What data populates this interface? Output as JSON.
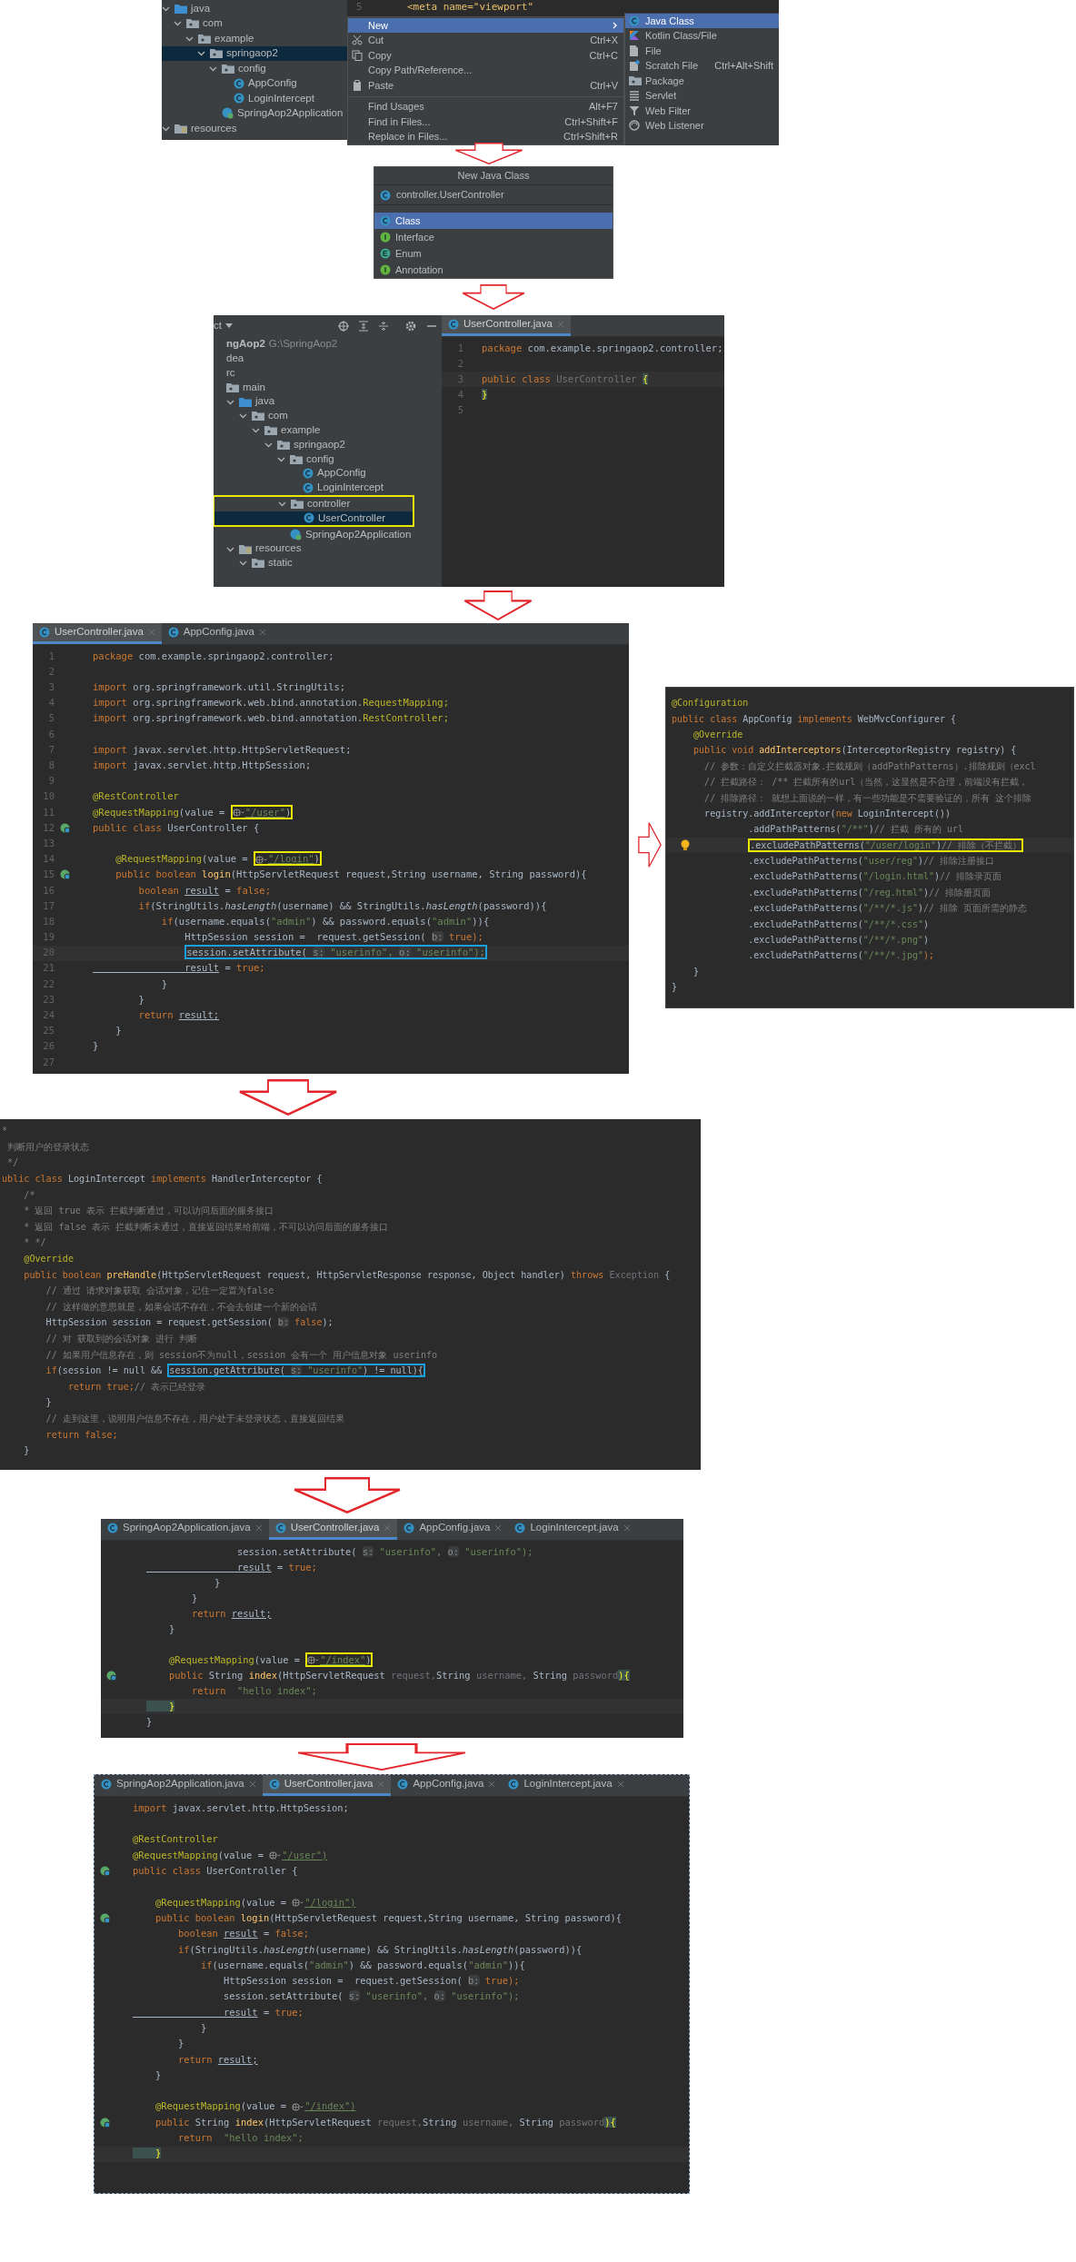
{
  "menu_screenshot": {
    "tree": [
      {
        "label": "java",
        "kind": "source",
        "expanded": true,
        "selected": false,
        "children": [
          {
            "label": "com",
            "kind": "folder",
            "expanded": true,
            "selected": false,
            "children": [
              {
                "label": "example",
                "kind": "folder",
                "expanded": true,
                "selected": false,
                "children": [
                  {
                    "label": "springaop2",
                    "kind": "folder",
                    "expanded": true,
                    "selected": true,
                    "children": [
                      {
                        "label": "config",
                        "kind": "folder",
                        "expanded": true,
                        "selected": false,
                        "children": [
                          {
                            "label": "AppConfig",
                            "kind": "class",
                            "selected": false
                          },
                          {
                            "label": "LoginIntercept",
                            "kind": "class",
                            "selected": false
                          }
                        ]
                      },
                      {
                        "label": "SpringAop2Application",
                        "kind": "app",
                        "selected": false
                      }
                    ]
                  }
                ]
              }
            ]
          }
        ]
      },
      {
        "label": "resources",
        "kind": "resources",
        "expanded": true,
        "selected": false
      }
    ],
    "editor_line": {
      "number": "5",
      "text": "<meta name=\"viewport\""
    },
    "menu": [
      {
        "kind": "submenu",
        "label": "New",
        "selected": true
      },
      {
        "kind": "cut",
        "label": "Cut",
        "shortcut": "Ctrl+X",
        "selected": false
      },
      {
        "kind": "copy",
        "label": "Copy",
        "shortcut": "Ctrl+C",
        "selected": false
      },
      {
        "kind": "plain",
        "label": "Copy Path/Reference...",
        "selected": false
      },
      {
        "kind": "paste",
        "label": "Paste",
        "shortcut": "Ctrl+V",
        "selected": false
      },
      {
        "kind": "separator"
      },
      {
        "kind": "plain",
        "label": "Find Usages",
        "shortcut": "Alt+F7",
        "selected": false
      },
      {
        "kind": "plain",
        "label": "Find in Files...",
        "shortcut": "Ctrl+Shift+F",
        "selected": false
      },
      {
        "kind": "plain",
        "label": "Replace in Files...",
        "shortcut": "Ctrl+Shift+R",
        "selected": false
      }
    ],
    "submenu": [
      {
        "kind": "class",
        "label": "Java Class",
        "selected": true
      },
      {
        "kind": "kotlin",
        "label": "Kotlin Class/File",
        "selected": false
      },
      {
        "kind": "file",
        "label": "File",
        "selected": false
      },
      {
        "kind": "scratch",
        "label": "Scratch File",
        "shortcut": "Ctrl+Alt+Shift",
        "selected": false
      },
      {
        "kind": "package",
        "label": "Package",
        "selected": false
      },
      {
        "kind": "servlet",
        "label": "Servlet",
        "selected": false
      },
      {
        "kind": "filter",
        "label": "Web Filter",
        "selected": false
      },
      {
        "kind": "listener",
        "label": "Web Listener",
        "selected": false
      }
    ]
  },
  "new_class_dialog": {
    "title": "New Java Class",
    "value": "controller.UserController",
    "options": [
      {
        "kind": "class",
        "label": "Class",
        "selected": true
      },
      {
        "kind": "interface",
        "label": "Interface",
        "selected": false
      },
      {
        "kind": "enum",
        "label": "Enum",
        "selected": false
      },
      {
        "kind": "annotation",
        "label": "Annotation",
        "selected": false
      }
    ]
  },
  "project_screenshot": {
    "toolbar_label": "ct",
    "tree": [
      {
        "label": "ngAop2",
        "path": "G:\\SpringAop2",
        "kind": "text",
        "selected": false
      },
      {
        "label": "dea",
        "kind": "text",
        "selected": false
      },
      {
        "label": "rc",
        "kind": "text",
        "selected": false
      },
      {
        "label": "main",
        "kind": "folder",
        "selected": false,
        "children": [
          {
            "label": "java",
            "kind": "source",
            "expanded": true,
            "selected": false,
            "children": [
              {
                "label": "com",
                "kind": "folder",
                "expanded": true,
                "selected": false,
                "children": [
                  {
                    "label": "example",
                    "kind": "folder",
                    "expanded": true,
                    "selected": false,
                    "children": [
                      {
                        "label": "springaop2",
                        "kind": "folder",
                        "expanded": true,
                        "selected": false,
                        "children": [
                          {
                            "label": "config",
                            "kind": "folder",
                            "expanded": true,
                            "selected": false,
                            "children": [
                              {
                                "label": "AppConfig",
                                "kind": "class",
                                "selected": false
                              },
                              {
                                "label": "LoginIntercept",
                                "kind": "class",
                                "selected": false
                              }
                            ]
                          },
                          {
                            "label": "controller",
                            "kind": "folder",
                            "expanded": true,
                            "selected": false,
                            "boxed": true,
                            "children": [
                              {
                                "label": "UserController",
                                "kind": "class",
                                "selected": true
                              }
                            ]
                          },
                          {
                            "label": "SpringAop2Application",
                            "kind": "app",
                            "selected": false
                          }
                        ]
                      }
                    ]
                  }
                ]
              }
            ]
          },
          {
            "label": "resources",
            "kind": "resources",
            "expanded": true,
            "selected": false,
            "children": [
              {
                "label": "static",
                "kind": "folder",
                "expanded": true,
                "selected": false
              }
            ]
          }
        ]
      }
    ],
    "tabs": [
      {
        "label": "UserController.java",
        "selected": true
      }
    ],
    "lines": [
      {
        "number": "1",
        "segments": [
          {
            "kind": "keyword",
            "text": "package "
          },
          {
            "kind": "plain",
            "text": "com.example.springaop2.controller;"
          }
        ]
      },
      {
        "number": "2"
      },
      {
        "number": "3",
        "current": true,
        "segments": [
          {
            "kind": "keyword",
            "text": "public class "
          },
          {
            "kind": "muted",
            "text": "UserController "
          },
          {
            "kind": "brace",
            "text": "{"
          }
        ]
      },
      {
        "number": "4",
        "segments": [
          {
            "kind": "brace",
            "text": "}"
          }
        ]
      },
      {
        "number": "5"
      }
    ]
  },
  "user_controller": {
    "tabs": [
      {
        "label": "UserController.java",
        "selected": true
      },
      {
        "label": "AppConfig.java",
        "selected": false
      }
    ],
    "lines": [
      {
        "number": "1",
        "segments": [
          {
            "kind": "keyword",
            "text": "package "
          },
          {
            "kind": "plain",
            "text": "com.example.springaop2.controller;"
          }
        ]
      },
      {
        "number": "2"
      },
      {
        "number": "3",
        "segments": [
          {
            "kind": "keyword",
            "text": "import "
          },
          {
            "kind": "plain",
            "text": "org.springframework.util.StringUtils;"
          }
        ]
      },
      {
        "number": "4",
        "segments": [
          {
            "kind": "keyword",
            "text": "import "
          },
          {
            "kind": "plain",
            "text": "org.springframework.web.bind.annotation."
          },
          {
            "kind": "annotation",
            "text": "RequestMapping;"
          }
        ]
      },
      {
        "number": "5",
        "segments": [
          {
            "kind": "keyword",
            "text": "import "
          },
          {
            "kind": "plain",
            "text": "org.springframework.web.bind.annotation."
          },
          {
            "kind": "annotation",
            "text": "RestController;"
          }
        ]
      },
      {
        "number": "6"
      },
      {
        "number": "7",
        "segments": [
          {
            "kind": "keyword",
            "text": "import "
          },
          {
            "kind": "plain",
            "text": "javax.servlet.http.HttpServletRequest;"
          }
        ]
      },
      {
        "number": "8",
        "segments": [
          {
            "kind": "keyword",
            "text": "import "
          },
          {
            "kind": "plain",
            "text": "javax.servlet.http.HttpSession;"
          }
        ]
      },
      {
        "number": "9"
      },
      {
        "number": "10",
        "segments": [
          {
            "kind": "annotation",
            "text": "@RestController"
          }
        ]
      },
      {
        "number": "11",
        "segments": [
          {
            "kind": "annotation",
            "text": "@RequestMapping"
          },
          {
            "kind": "plain",
            "text": "(value = "
          },
          {
            "kind": "box",
            "color": "#e8e800",
            "segments": [
              {
                "kind": "globe"
              },
              {
                "kind": "url",
                "text": "\"/user\""
              },
              {
                "kind": "plain",
                "text": ")"
              }
            ]
          }
        ]
      },
      {
        "number": "12",
        "gutter": {
          "kind": "bean"
        },
        "segments": [
          {
            "kind": "keyword",
            "text": "public class "
          },
          {
            "kind": "plain",
            "text": "UserController {"
          }
        ]
      },
      {
        "number": "13"
      },
      {
        "number": "14",
        "segments": [
          {
            "kind": "annotation",
            "text": "    @RequestMapping"
          },
          {
            "kind": "plain",
            "text": "(value = "
          },
          {
            "kind": "box",
            "color": "#e8e800",
            "segments": [
              {
                "kind": "globe"
              },
              {
                "kind": "url",
                "text": "\"/login\""
              },
              {
                "kind": "plain",
                "text": ")"
              }
            ]
          }
        ]
      },
      {
        "number": "15",
        "gutter": {
          "kind": "bean"
        },
        "segments": [
          {
            "kind": "keyword",
            "text": "    public boolean "
          },
          {
            "kind": "method",
            "text": "login"
          },
          {
            "kind": "plain",
            "text": "(HttpServletRequest request,String username, String password){"
          }
        ]
      },
      {
        "number": "16",
        "segments": [
          {
            "kind": "keyword",
            "text": "        boolean "
          },
          {
            "kind": "underline",
            "text": "result"
          },
          {
            "kind": "plain",
            "text": " = "
          },
          {
            "kind": "keyword",
            "text": "false;"
          }
        ]
      },
      {
        "number": "17",
        "segments": [
          {
            "kind": "keyword",
            "text": "        if"
          },
          {
            "kind": "plain",
            "text": "(StringUtils."
          },
          {
            "kind": "italic",
            "text": "hasLength"
          },
          {
            "kind": "plain",
            "text": "(username) && StringUtils."
          },
          {
            "kind": "italic",
            "text": "hasLength"
          },
          {
            "kind": "plain",
            "text": "(password)){"
          }
        ]
      },
      {
        "number": "18",
        "segments": [
          {
            "kind": "keyword",
            "text": "            if"
          },
          {
            "kind": "plain",
            "text": "(username.equals("
          },
          {
            "kind": "string",
            "text": "\"admin\""
          },
          {
            "kind": "plain",
            "text": ") && password.equals("
          },
          {
            "kind": "string",
            "text": "\"admin\""
          },
          {
            "kind": "plain",
            "text": ")){"
          }
        ]
      },
      {
        "number": "19",
        "segments": [
          {
            "kind": "plain",
            "text": "                HttpSession session =  request.getSession( "
          },
          {
            "kind": "hint",
            "text": "b:"
          },
          {
            "kind": "keyword",
            "text": " true);"
          }
        ]
      },
      {
        "number": "20",
        "current": true,
        "segments": [
          {
            "kind": "box",
            "color": "#1a9fe0",
            "segments": [
              {
                "kind": "plain",
                "text": "                session.setAttribute( "
              },
              {
                "kind": "hint",
                "text": "s:"
              },
              {
                "kind": "string",
                "text": " \"userinfo\", "
              },
              {
                "kind": "hint",
                "text": "o:"
              },
              {
                "kind": "string",
                "text": " \"userinfo\");"
              }
            ]
          }
        ]
      },
      {
        "number": "21",
        "segments": [
          {
            "kind": "underline",
            "text": "                result"
          },
          {
            "kind": "plain",
            "text": " = "
          },
          {
            "kind": "keyword",
            "text": "true;"
          }
        ]
      },
      {
        "number": "22",
        "segments": [
          {
            "kind": "plain",
            "text": "            }"
          }
        ]
      },
      {
        "number": "23",
        "segments": [
          {
            "kind": "plain",
            "text": "        }"
          }
        ]
      },
      {
        "number": "24",
        "segments": [
          {
            "kind": "keyword",
            "text": "        return "
          },
          {
            "kind": "underline",
            "text": "result;"
          }
        ]
      },
      {
        "number": "25",
        "segments": [
          {
            "kind": "plain",
            "text": "    }"
          }
        ]
      },
      {
        "number": "26",
        "segments": [
          {
            "kind": "plain",
            "text": "}"
          }
        ]
      },
      {
        "number": "27"
      }
    ]
  },
  "app_config": {
    "lines": [
      {
        "segments": [
          {
            "kind": "annotation",
            "text": "@Configuration"
          }
        ]
      },
      {
        "segments": [
          {
            "kind": "keyword",
            "text": "public class "
          },
          {
            "kind": "plain",
            "text": "AppConfig "
          },
          {
            "kind": "keyword",
            "text": "implements "
          },
          {
            "kind": "plain",
            "text": "WebMvcConfigurer {"
          }
        ]
      },
      {
        "segments": [
          {
            "kind": "annotation",
            "text": "    @Override"
          }
        ]
      },
      {
        "segments": [
          {
            "kind": "keyword",
            "text": "    public void "
          },
          {
            "kind": "method",
            "text": "addInterceptors"
          },
          {
            "kind": "plain",
            "text": "(InterceptorRegistry registry) {"
          }
        ]
      },
      {
        "segments": [
          {
            "kind": "comment",
            "text": "      // 参数：自定义拦截器对象.拦截规则（addPathPatterns）.排除规则（excl"
          }
        ]
      },
      {
        "segments": [
          {
            "kind": "comment",
            "text": "      // 拦截路径： /** 拦截所有的url（当然，这显然是不合理，前端没有拦截，"
          }
        ]
      },
      {
        "segments": [
          {
            "kind": "comment",
            "text": "      // 排除路径： 就想上面说的一样，有一些功能是不需要验证的，所有 这个排除"
          }
        ]
      },
      {
        "segments": [
          {
            "kind": "plain",
            "text": "      registry.addInterceptor("
          },
          {
            "kind": "keyword",
            "text": "new "
          },
          {
            "kind": "plain",
            "text": "LoginIntercept())"
          }
        ]
      },
      {
        "segments": [
          {
            "kind": "plain",
            "text": "              .addPathPatterns("
          },
          {
            "kind": "string",
            "text": "\"/**\""
          },
          {
            "kind": "plain",
            "text": ")"
          },
          {
            "kind": "comment",
            "text": "// 拦截 所有的 url"
          }
        ]
      },
      {
        "current": true,
        "gutter": {
          "kind": "bulb"
        },
        "segments": [
          {
            "kind": "box",
            "color": "#e8e800",
            "segments": [
              {
                "kind": "plain",
                "text": "              .excludePathPatterns("
              },
              {
                "kind": "string",
                "text": "\"/user/login\""
              },
              {
                "kind": "plain",
                "text": ")"
              },
              {
                "kind": "comment",
                "text": "// 排除（不拦截）"
              }
            ]
          }
        ]
      },
      {
        "segments": [
          {
            "kind": "plain",
            "text": "              .excludePathPatterns("
          },
          {
            "kind": "string",
            "text": "\"user/reg\""
          },
          {
            "kind": "plain",
            "text": ")"
          },
          {
            "kind": "comment",
            "text": "// 排除注册接口"
          }
        ]
      },
      {
        "segments": [
          {
            "kind": "plain",
            "text": "              .excludePathPatterns("
          },
          {
            "kind": "string",
            "text": "\"/login.html\""
          },
          {
            "kind": "plain",
            "text": ")"
          },
          {
            "kind": "comment",
            "text": "// 排除录页面"
          }
        ]
      },
      {
        "segments": [
          {
            "kind": "plain",
            "text": "              .excludePathPatterns("
          },
          {
            "kind": "string",
            "text": "\"/reg.html\""
          },
          {
            "kind": "plain",
            "text": ")"
          },
          {
            "kind": "comment",
            "text": "// 排除册页面"
          }
        ]
      },
      {
        "segments": [
          {
            "kind": "plain",
            "text": "              .excludePathPatterns("
          },
          {
            "kind": "string",
            "text": "\"/**/*.js\""
          },
          {
            "kind": "plain",
            "text": ")"
          },
          {
            "kind": "comment",
            "text": "// 排除 页面所需的静态"
          }
        ]
      },
      {
        "segments": [
          {
            "kind": "plain",
            "text": "              .excludePathPatterns("
          },
          {
            "kind": "string",
            "text": "\"/**/*.css\""
          },
          {
            "kind": "plain",
            "text": ")"
          }
        ]
      },
      {
        "segments": [
          {
            "kind": "plain",
            "text": "              .excludePathPatterns("
          },
          {
            "kind": "string",
            "text": "\"/**/*.png\""
          },
          {
            "kind": "plain",
            "text": ")"
          }
        ]
      },
      {
        "segments": [
          {
            "kind": "plain",
            "text": "              .excludePathPatterns("
          },
          {
            "kind": "string",
            "text": "\"/**/*.jpg\""
          },
          {
            "kind": "keyword",
            "text": ");"
          }
        ]
      },
      {
        "segments": [
          {
            "kind": "plain",
            "text": "    }"
          }
        ]
      },
      {
        "segments": [
          {
            "kind": "plain",
            "text": "}"
          }
        ]
      }
    ]
  },
  "login_intercept": {
    "lines": [
      {
        "segments": [
          {
            "kind": "comment",
            "text": "*"
          }
        ]
      },
      {
        "segments": [
          {
            "kind": "comment",
            "text": " 判断用户的登录状态"
          }
        ]
      },
      {
        "segments": [
          {
            "kind": "comment",
            "text": " */"
          }
        ]
      },
      {
        "segments": [
          {
            "kind": "keyword",
            "text": "ublic class "
          },
          {
            "kind": "plain",
            "text": "LoginIntercept "
          },
          {
            "kind": "keyword",
            "text": "implements "
          },
          {
            "kind": "plain",
            "text": "HandlerInterceptor {"
          }
        ]
      },
      {
        "segments": [
          {
            "kind": "comment",
            "text": "    /*"
          }
        ]
      },
      {
        "segments": [
          {
            "kind": "comment",
            "text": "    * 返回 true 表示 拦截判断通过，可以访问后面的服务接口"
          }
        ]
      },
      {
        "segments": [
          {
            "kind": "comment",
            "text": "    * 返回 false 表示 拦截判断未通过，直接返回结果给前端，不可以访问后面的服务接口"
          }
        ]
      },
      {
        "segments": [
          {
            "kind": "comment",
            "text": "    * */"
          }
        ]
      },
      {
        "segments": [
          {
            "kind": "annotation",
            "text": "    @Override"
          }
        ]
      },
      {
        "segments": [
          {
            "kind": "keyword",
            "text": "    public boolean "
          },
          {
            "kind": "method",
            "text": "preHandle"
          },
          {
            "kind": "plain",
            "text": "(HttpServletRequest request, HttpServletResponse response, Object handler) "
          },
          {
            "kind": "keyword",
            "text": "throws "
          },
          {
            "kind": "muted",
            "text": "Exception "
          },
          {
            "kind": "plain",
            "text": "{"
          }
        ]
      },
      {
        "segments": [
          {
            "kind": "comment",
            "text": "        // 通过 请求对象获取 会话对象，记住一定置为false"
          }
        ]
      },
      {
        "segments": [
          {
            "kind": "comment",
            "text": "        // 这样做的意思就是，如果会话不存在，不会去创建一个新的会话"
          }
        ]
      },
      {
        "segments": [
          {
            "kind": "plain",
            "text": "        HttpSession session = request.getSession( "
          },
          {
            "kind": "hint",
            "text": "b:"
          },
          {
            "kind": "keyword",
            "text": " false"
          },
          {
            "kind": "plain",
            "text": ");"
          }
        ]
      },
      {
        "segments": [
          {
            "kind": "comment",
            "text": "        // 对 获取到的会话对象 进行 判断"
          }
        ]
      },
      {
        "segments": [
          {
            "kind": "comment",
            "text": "        // 如果用户信息存在，则 session不为null，session 会有一个 用户信息对象 userinfo"
          }
        ]
      },
      {
        "segments": [
          {
            "kind": "keyword",
            "text": "        if"
          },
          {
            "kind": "plain",
            "text": "(session != null && "
          },
          {
            "kind": "box",
            "color": "#1a9fe0",
            "segments": [
              {
                "kind": "plain",
                "text": "session.getAttribute( "
              },
              {
                "kind": "hint",
                "text": "s:"
              },
              {
                "kind": "string",
                "text": " \"userinfo\""
              },
              {
                "kind": "plain",
                "text": ") != null){"
              }
            ]
          }
        ]
      },
      {
        "segments": [
          {
            "kind": "keyword",
            "text": "            return true;"
          },
          {
            "kind": "comment",
            "text": "// 表示已经登录"
          }
        ]
      },
      {
        "segments": [
          {
            "kind": "plain",
            "text": "        }"
          }
        ]
      },
      {
        "segments": [
          {
            "kind": "comment",
            "text": "        // 走到这里，说明用户信息不存在，用户处于未登录状态，直接返回结果"
          }
        ]
      },
      {
        "segments": [
          {
            "kind": "keyword",
            "text": "        return false;"
          }
        ]
      },
      {
        "segments": [
          {
            "kind": "plain",
            "text": "    }"
          }
        ]
      }
    ]
  },
  "index_snippet": {
    "tabs": [
      {
        "label": "SpringAop2Application.java",
        "selected": false
      },
      {
        "label": "UserController.java",
        "selected": true
      },
      {
        "label": "AppConfig.java",
        "selected": false
      },
      {
        "label": "LoginIntercept.java",
        "selected": false
      }
    ],
    "lines": [
      {
        "segments": [
          {
            "kind": "plain",
            "text": "                session.setAttribute( "
          },
          {
            "kind": "hint",
            "text": "s:"
          },
          {
            "kind": "string",
            "text": " \"userinfo\", "
          },
          {
            "kind": "hint",
            "text": "o:"
          },
          {
            "kind": "string",
            "text": " \"userinfo\");"
          }
        ]
      },
      {
        "segments": [
          {
            "kind": "underline",
            "text": "                result"
          },
          {
            "kind": "plain",
            "text": " = "
          },
          {
            "kind": "keyword",
            "text": "true;"
          }
        ]
      },
      {
        "segments": [
          {
            "kind": "plain",
            "text": "            }"
          }
        ]
      },
      {
        "segments": [
          {
            "kind": "plain",
            "text": "        }"
          }
        ]
      },
      {
        "segments": [
          {
            "kind": "keyword",
            "text": "        return "
          },
          {
            "kind": "underline",
            "text": "result;"
          }
        ]
      },
      {
        "segments": [
          {
            "kind": "plain",
            "text": "    }"
          }
        ]
      },
      {
        "gap_before": true,
        "segments": [
          {
            "kind": "annotation",
            "text": "    @RequestMapping"
          },
          {
            "kind": "plain",
            "text": "(value = "
          },
          {
            "kind": "box",
            "color": "#e8e800",
            "segments": [
              {
                "kind": "globe"
              },
              {
                "kind": "url",
                "text": "\"/index\""
              },
              {
                "kind": "plain",
                "text": ")"
              }
            ]
          }
        ]
      },
      {
        "gutter": {
          "kind": "bean"
        },
        "segments": [
          {
            "kind": "keyword",
            "text": "    public "
          },
          {
            "kind": "plain",
            "text": "String "
          },
          {
            "kind": "method",
            "text": "index"
          },
          {
            "kind": "plain",
            "text": "(HttpServletRequest "
          },
          {
            "kind": "muted",
            "text": "request,"
          },
          {
            "kind": "plain",
            "text": "String "
          },
          {
            "kind": "muted",
            "text": "username, "
          },
          {
            "kind": "plain",
            "text": "String "
          },
          {
            "kind": "muted",
            "text": "password"
          },
          {
            "kind": "brace",
            "text": "){"
          }
        ]
      },
      {
        "segments": [
          {
            "kind": "keyword",
            "text": "        return  "
          },
          {
            "kind": "string",
            "text": "\"hello index\";"
          }
        ]
      },
      {
        "current": true,
        "segments": [
          {
            "kind": "brace",
            "text": "    }"
          }
        ]
      },
      {
        "segments": [
          {
            "kind": "plain",
            "text": "}"
          }
        ]
      }
    ]
  },
  "final_code": {
    "tabs": [
      {
        "label": "SpringAop2Application.java",
        "selected": false
      },
      {
        "label": "UserController.java",
        "selected": true
      },
      {
        "label": "AppConfig.java",
        "selected": false
      },
      {
        "label": "LoginIntercept.java",
        "selected": false
      }
    ],
    "lines": [
      {
        "segments": [
          {
            "kind": "keyword",
            "text": "import "
          },
          {
            "kind": "plain",
            "text": "javax.servlet.http.HttpSession;"
          }
        ]
      },
      {
        "gap_before": true,
        "segments": [
          {
            "kind": "annotation",
            "text": "@RestController"
          }
        ]
      },
      {
        "segments": [
          {
            "kind": "annotation",
            "text": "@RequestMapping"
          },
          {
            "kind": "plain",
            "text": "(value = "
          },
          {
            "kind": "globe"
          },
          {
            "kind": "url",
            "text": "\"/user\")"
          }
        ]
      },
      {
        "gutter": {
          "kind": "bean"
        },
        "segments": [
          {
            "kind": "keyword",
            "text": "public class "
          },
          {
            "kind": "plain",
            "text": "UserController {"
          }
        ]
      },
      {
        "gap_before": true,
        "segments": [
          {
            "kind": "annotation",
            "text": "    @RequestMapping"
          },
          {
            "kind": "plain",
            "text": "(value = "
          },
          {
            "kind": "globe"
          },
          {
            "kind": "url",
            "text": "\"/login\")"
          }
        ]
      },
      {
        "gutter": {
          "kind": "bean"
        },
        "segments": [
          {
            "kind": "keyword",
            "text": "    public boolean "
          },
          {
            "kind": "method",
            "text": "login"
          },
          {
            "kind": "plain",
            "text": "(HttpServletRequest request,String username, String password){"
          }
        ]
      },
      {
        "segments": [
          {
            "kind": "keyword",
            "text": "        boolean "
          },
          {
            "kind": "underline",
            "text": "result"
          },
          {
            "kind": "plain",
            "text": " = "
          },
          {
            "kind": "keyword",
            "text": "false;"
          }
        ]
      },
      {
        "segments": [
          {
            "kind": "keyword",
            "text": "        if"
          },
          {
            "kind": "plain",
            "text": "(StringUtils."
          },
          {
            "kind": "italic",
            "text": "hasLength"
          },
          {
            "kind": "plain",
            "text": "(username) && StringUtils."
          },
          {
            "kind": "italic",
            "text": "hasLength"
          },
          {
            "kind": "plain",
            "text": "(password)){"
          }
        ]
      },
      {
        "segments": [
          {
            "kind": "keyword",
            "text": "            if"
          },
          {
            "kind": "plain",
            "text": "(username.equals("
          },
          {
            "kind": "string",
            "text": "\"admin\""
          },
          {
            "kind": "plain",
            "text": ") && password.equals("
          },
          {
            "kind": "string",
            "text": "\"admin\""
          },
          {
            "kind": "plain",
            "text": ")){"
          }
        ]
      },
      {
        "segments": [
          {
            "kind": "plain",
            "text": "                HttpSession session =  request.getSession( "
          },
          {
            "kind": "hint",
            "text": "b:"
          },
          {
            "kind": "keyword",
            "text": " true);"
          }
        ]
      },
      {
        "segments": [
          {
            "kind": "plain",
            "text": "                session.setAttribute( "
          },
          {
            "kind": "hint",
            "text": "s:"
          },
          {
            "kind": "string",
            "text": " \"userinfo\", "
          },
          {
            "kind": "hint",
            "text": "o:"
          },
          {
            "kind": "string",
            "text": " \"userinfo\");"
          }
        ]
      },
      {
        "segments": [
          {
            "kind": "underline",
            "text": "                result"
          },
          {
            "kind": "plain",
            "text": " = "
          },
          {
            "kind": "keyword",
            "text": "true;"
          }
        ]
      },
      {
        "segments": [
          {
            "kind": "plain",
            "text": "            }"
          }
        ]
      },
      {
        "segments": [
          {
            "kind": "plain",
            "text": "        }"
          }
        ]
      },
      {
        "segments": [
          {
            "kind": "keyword",
            "text": "        return "
          },
          {
            "kind": "underline",
            "text": "result;"
          }
        ]
      },
      {
        "segments": [
          {
            "kind": "plain",
            "text": "    }"
          }
        ]
      },
      {
        "gap_before": true,
        "segments": [
          {
            "kind": "annotation",
            "text": "    @RequestMapping"
          },
          {
            "kind": "plain",
            "text": "(value = "
          },
          {
            "kind": "globe"
          },
          {
            "kind": "url",
            "text": "\"/index\")"
          }
        ]
      },
      {
        "gutter": {
          "kind": "bean"
        },
        "segments": [
          {
            "kind": "keyword",
            "text": "    public "
          },
          {
            "kind": "plain",
            "text": "String "
          },
          {
            "kind": "method",
            "text": "index"
          },
          {
            "kind": "plain",
            "text": "(HttpServletRequest "
          },
          {
            "kind": "muted",
            "text": "request,"
          },
          {
            "kind": "plain",
            "text": "String "
          },
          {
            "kind": "muted",
            "text": "username, "
          },
          {
            "kind": "plain",
            "text": "String "
          },
          {
            "kind": "muted",
            "text": "password"
          },
          {
            "kind": "brace",
            "text": "){"
          }
        ]
      },
      {
        "segments": [
          {
            "kind": "keyword",
            "text": "        return  "
          },
          {
            "kind": "string",
            "text": "\"hello index\";"
          }
        ]
      },
      {
        "current": true,
        "segments": [
          {
            "kind": "brace",
            "text": "    }"
          }
        ]
      }
    ]
  }
}
